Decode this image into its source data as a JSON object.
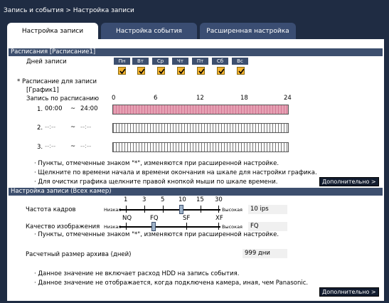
{
  "breadcrumb": "Запись и события > Настройка записи",
  "tabs": [
    {
      "label": "Настройка записи",
      "active": true
    },
    {
      "label": "Настройка события",
      "active": false
    },
    {
      "label": "Расширенная настройка",
      "active": false
    }
  ],
  "schedule": {
    "header": "Расписания [Расписание1]",
    "days_label": "Дней записи",
    "days": [
      "Пн",
      "Вт",
      "Ср",
      "Чт",
      "Пт",
      "Сб",
      "Вс"
    ],
    "days_checked": [
      true,
      true,
      true,
      true,
      true,
      true,
      true
    ],
    "schedule_label": "* Расписание для записи",
    "graph_label": "[График1]",
    "by_schedule_label": "Запись по расписанию",
    "scale": [
      "0",
      "6",
      "12",
      "18",
      "24"
    ],
    "rows": [
      {
        "num": "1.",
        "start": "00:00",
        "sep": "~",
        "end": "24:00",
        "filled": true
      },
      {
        "num": "2.",
        "start": "--:--",
        "sep": "~",
        "end": "--:--",
        "filled": false
      },
      {
        "num": "3.",
        "start": "--:--",
        "sep": "~",
        "end": "--:--",
        "filled": false
      }
    ],
    "notes": [
      "· Пункты, отмеченные знаком \"*\", изменяются при расширенной настройке.",
      "· Щелкните по времени начала и времени окончания на шкале для настройки графика.",
      "· Для очистки графика щелкните правой кнопкой мыши по шкале времени."
    ],
    "more_button": "Дополнительно >"
  },
  "record": {
    "header": "Настройка записи (Всех камер)",
    "fps_scale": [
      "1",
      "3",
      "5",
      "10",
      "15",
      "30"
    ],
    "fps_label": "Частота кадров",
    "low": "Низкая",
    "high": "Высокая",
    "fps_value": "10 ips",
    "quality_scale": [
      "NQ",
      "FQ",
      "SF",
      "XF"
    ],
    "quality_label": "Качество изображения",
    "quality_value": "FQ",
    "note": "· Пункты, отмеченные знаком \"*\", изменяются при расширенной настройке.",
    "archive_label": "Расчетный размер архива (дней)",
    "archive_value": "999 дни",
    "notes": [
      "· Данное значение не включает расход HDD на запись события.",
      "· Данное значение не отображается, когда подключена камера, иная, чем Panasonic."
    ],
    "more_button": "Дополнительно >"
  },
  "colors": {
    "background": "#1f2c43",
    "section": "#3d4f6e",
    "checkbox": "#f3b22e",
    "schedule_bar": "#e6a0b3"
  }
}
